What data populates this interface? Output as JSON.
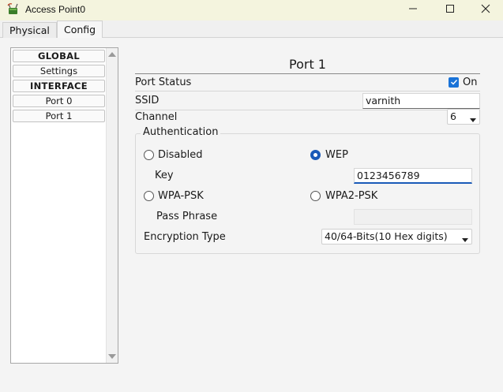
{
  "window": {
    "title": "Access Point0",
    "icon": "access-point-app-icon",
    "controls": {
      "minimize": "minimize-icon",
      "maximize": "maximize-icon",
      "close": "close-icon"
    }
  },
  "tabs": [
    {
      "label": "Physical",
      "active": false
    },
    {
      "label": "Config",
      "active": true
    }
  ],
  "sidebar": {
    "items": [
      {
        "label": "GLOBAL",
        "type": "header"
      },
      {
        "label": "Settings",
        "type": "item"
      },
      {
        "label": "INTERFACE",
        "type": "header"
      },
      {
        "label": "Port 0",
        "type": "item"
      },
      {
        "label": "Port 1",
        "type": "item"
      }
    ]
  },
  "main": {
    "title": "Port 1",
    "port_status": {
      "label": "Port Status",
      "checked": true,
      "value_label": "On"
    },
    "ssid": {
      "label": "SSID",
      "value": "varnith"
    },
    "channel": {
      "label": "Channel",
      "value": "6"
    },
    "authentication": {
      "legend": "Authentication",
      "options": {
        "disabled": {
          "label": "Disabled",
          "checked": false
        },
        "wep": {
          "label": "WEP",
          "checked": true
        },
        "wpa_psk": {
          "label": "WPA-PSK",
          "checked": false
        },
        "wpa2_psk": {
          "label": "WPA2-PSK",
          "checked": false
        }
      },
      "key": {
        "label": "Key",
        "value": "0123456789"
      },
      "pass_phrase": {
        "label": "Pass Phrase",
        "value": ""
      },
      "encryption": {
        "label": "Encryption Type",
        "value": "40/64-Bits(10 Hex digits)"
      }
    }
  },
  "colors": {
    "titlebar_bg": "#f4f4de",
    "accent": "#1a73d8",
    "radio_selected": "#1a5ab8"
  }
}
